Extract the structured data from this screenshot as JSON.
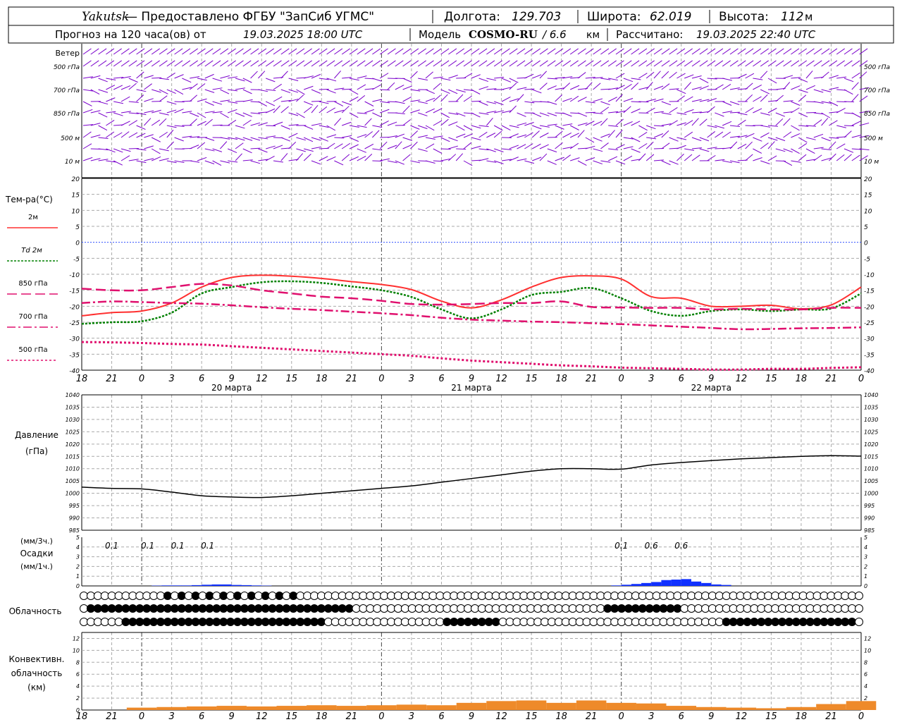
{
  "header": {
    "station": "Yakutsk",
    "provider": "— Предоставлено ФГБУ \"ЗапСиб УГМС\"",
    "lon_label": "Долгота:",
    "lon": "129.703",
    "lat_label": "Широта:",
    "lat": "62.019",
    "alt_label": "Высота:",
    "alt": "112",
    "alt_unit": "м",
    "forecast_label": "Прогноз на 120 часа(ов) от",
    "forecast_time": "19.03.2025 18:00 UTC",
    "model_label": "Модель",
    "model": "COSMO-RU",
    "model_res": "/ 6.6",
    "model_res_unit": "км",
    "calc_label": "Рассчитано:",
    "calc_time": "19.03.2025 22:40 UTC"
  },
  "wind_panel": {
    "title": "Ветер",
    "levels": [
      "500 гПа",
      "700 гПа",
      "850 гПа",
      "500 м",
      "10 м"
    ]
  },
  "temp_panel": {
    "title": "Тем-ра(°C)",
    "legend": [
      {
        "label": "2м",
        "color": "#ff3030"
      },
      {
        "label": "Td  2м",
        "color": "#008000"
      },
      {
        "label": "850 гПа",
        "color": "#e0106e"
      },
      {
        "label": "700 гПа",
        "color": "#e0106e"
      },
      {
        "label": "500 гПа",
        "color": "#e0106e"
      }
    ]
  },
  "pressure_panel": {
    "title": "Давление",
    "unit": "(гПа)"
  },
  "precip_panel": {
    "unit_top": "(мм/3ч.)",
    "title": "Осадки",
    "unit_bottom": "(мм/1ч.)",
    "labels": [
      {
        "h": 3,
        "text": "0.1"
      },
      {
        "h": 6.6,
        "text": "0.1"
      },
      {
        "h": 9.6,
        "text": "0.1"
      },
      {
        "h": 12.6,
        "text": "0.1"
      },
      {
        "h": 54,
        "text": "0.1"
      },
      {
        "h": 57,
        "text": "0.6"
      },
      {
        "h": 60,
        "text": "0.6"
      }
    ]
  },
  "cloud_panel": {
    "title": "Облачность"
  },
  "conv_panel": {
    "title_1": "Конвективн.",
    "title_2": "облачность",
    "unit": "(км)"
  },
  "axis": {
    "hour_labels": [
      "18",
      "21",
      "0",
      "3",
      "6",
      "9",
      "12",
      "15",
      "18",
      "21",
      "0",
      "3",
      "6",
      "9",
      "12",
      "15",
      "18",
      "21",
      "0",
      "3",
      "6",
      "9",
      "12",
      "15",
      "18",
      "21",
      "0"
    ],
    "day_labels": [
      {
        "h": 15,
        "text": "20 марта"
      },
      {
        "h": 39,
        "text": "21 марта"
      },
      {
        "h": 63,
        "text": "22 марта"
      }
    ]
  },
  "colors": {
    "wind": "#7a00cc",
    "t2m": "#ff3030",
    "td2m": "#008000",
    "upper": "#e0106e",
    "pressure": "#000000",
    "precip": "#1030ff",
    "conv": "#ee8a2a",
    "grid": "#aaaaaa",
    "zero_line": "#3050ff"
  },
  "chart_data": [
    {
      "type": "line",
      "name": "temperature",
      "x_hours": [
        0,
        3,
        6,
        9,
        12,
        15,
        18,
        21,
        24,
        27,
        30,
        33,
        36,
        39,
        42,
        45,
        48,
        51,
        54,
        57,
        60,
        63,
        66,
        69,
        72,
        75,
        78
      ],
      "series": [
        {
          "name": "2м",
          "values": [
            -23,
            -22,
            -21.5,
            -19,
            -14,
            -11,
            -10.3,
            -10.6,
            -11.3,
            -12.3,
            -13.2,
            -14.8,
            -18.4,
            -20.5,
            -18,
            -14,
            -11,
            -10.5,
            -11.5,
            -17,
            -17.5,
            -20,
            -20,
            -19.7,
            -20.8,
            -19.6,
            -14
          ]
        },
        {
          "name": "Td  2м",
          "values": [
            -25.5,
            -25,
            -24.7,
            -22,
            -16,
            -14,
            -12.5,
            -12.2,
            -12.7,
            -13.8,
            -15,
            -17.1,
            -21,
            -23.8,
            -21,
            -16.5,
            -15.5,
            -14.3,
            -17.5,
            -21.5,
            -23,
            -21.5,
            -21,
            -21.5,
            -21,
            -20.7,
            -16
          ]
        },
        {
          "name": "850 гПа",
          "values": [
            -14.5,
            -15,
            -15,
            -14,
            -13,
            -13.5,
            -15,
            -16,
            -17,
            -17.5,
            -18.3,
            -19.3,
            -19.5,
            -19.3,
            -19,
            -19,
            -18.5,
            -20.2,
            -20.4,
            -20.5,
            -20.5,
            -21,
            -20.8,
            -21,
            -21,
            -20.5,
            -20.5
          ]
        },
        {
          "name": "700 гПа",
          "values": [
            -19,
            -18.5,
            -18.7,
            -19,
            -19.2,
            -19.7,
            -20.3,
            -20.8,
            -21.2,
            -21.7,
            -22.2,
            -22.8,
            -23.6,
            -24.2,
            -24.5,
            -24.8,
            -25,
            -25.3,
            -25.6,
            -26,
            -26.4,
            -26.8,
            -27.2,
            -27.1,
            -26.9,
            -26.8,
            -26.6
          ]
        },
        {
          "name": "500 гПа",
          "values": [
            -31.2,
            -31.3,
            -31.5,
            -31.8,
            -32,
            -32.5,
            -33,
            -33.5,
            -34,
            -34.5,
            -35,
            -35.5,
            -36.3,
            -37,
            -37.5,
            -38,
            -38.5,
            -38.8,
            -39.2,
            -39.4,
            -39.6,
            -39.8,
            -39.8,
            -39.6,
            -39.6,
            -39.3,
            -39.1
          ]
        }
      ],
      "ylim": [
        -40,
        20
      ],
      "yticks": [
        -40,
        -35,
        -30,
        -25,
        -20,
        -15,
        -10,
        -5,
        0,
        5,
        10,
        15,
        20
      ]
    },
    {
      "type": "line",
      "name": "pressure",
      "x_hours": [
        0,
        3,
        6,
        9,
        12,
        15,
        18,
        21,
        24,
        27,
        30,
        33,
        36,
        39,
        42,
        45,
        48,
        51,
        54,
        57,
        60,
        63,
        66,
        69,
        72,
        75,
        78
      ],
      "series": [
        {
          "name": "Давление",
          "values": [
            1002.5,
            1002,
            1001.8,
            1000.5,
            999,
            998.5,
            998.3,
            999,
            1000,
            1001,
            1002,
            1003,
            1004.5,
            1006,
            1007.5,
            1009,
            1010,
            1010,
            1009.8,
            1011.5,
            1012.5,
            1013.3,
            1014,
            1014.5,
            1015,
            1015.3,
            1015.1
          ]
        }
      ],
      "ylim": [
        985,
        1040
      ],
      "yticks": [
        985,
        990,
        995,
        1000,
        1005,
        1010,
        1015,
        1020,
        1025,
        1030,
        1035,
        1040
      ]
    },
    {
      "type": "bar",
      "name": "precipitation",
      "x_hours": [
        7.5,
        8.5,
        9.5,
        10.5,
        11.5,
        12.5,
        13.5,
        14.5,
        15.5,
        16.5,
        17.5,
        18.5,
        53.5,
        54.5,
        55.5,
        56.5,
        57.5,
        58.5,
        59.5,
        60.5,
        61.5,
        62.5,
        63.5,
        64.5
      ],
      "values": [
        0.03,
        0.05,
        0.05,
        0.05,
        0.08,
        0.12,
        0.15,
        0.15,
        0.1,
        0.08,
        0.05,
        0.03,
        0.05,
        0.12,
        0.2,
        0.3,
        0.4,
        0.6,
        0.65,
        0.7,
        0.45,
        0.3,
        0.15,
        0.1
      ],
      "ylim": [
        0,
        5
      ]
    },
    {
      "type": "bar",
      "name": "convective_cloud",
      "x_hours": [
        6,
        9,
        12,
        15,
        18,
        21,
        24,
        27,
        30,
        33,
        36,
        39,
        42,
        45,
        48,
        51,
        54,
        57,
        60,
        63,
        66,
        69,
        72,
        75,
        78
      ],
      "values": [
        0.4,
        0.5,
        0.6,
        0.7,
        0.6,
        0.7,
        0.8,
        0.7,
        0.8,
        0.9,
        0.8,
        1.2,
        1.5,
        1.6,
        1.2,
        1.6,
        1.2,
        1.1,
        0.7,
        0.5,
        0.4,
        0.3,
        0.5,
        1.0,
        1.5
      ],
      "ylim": [
        0,
        13
      ]
    }
  ]
}
